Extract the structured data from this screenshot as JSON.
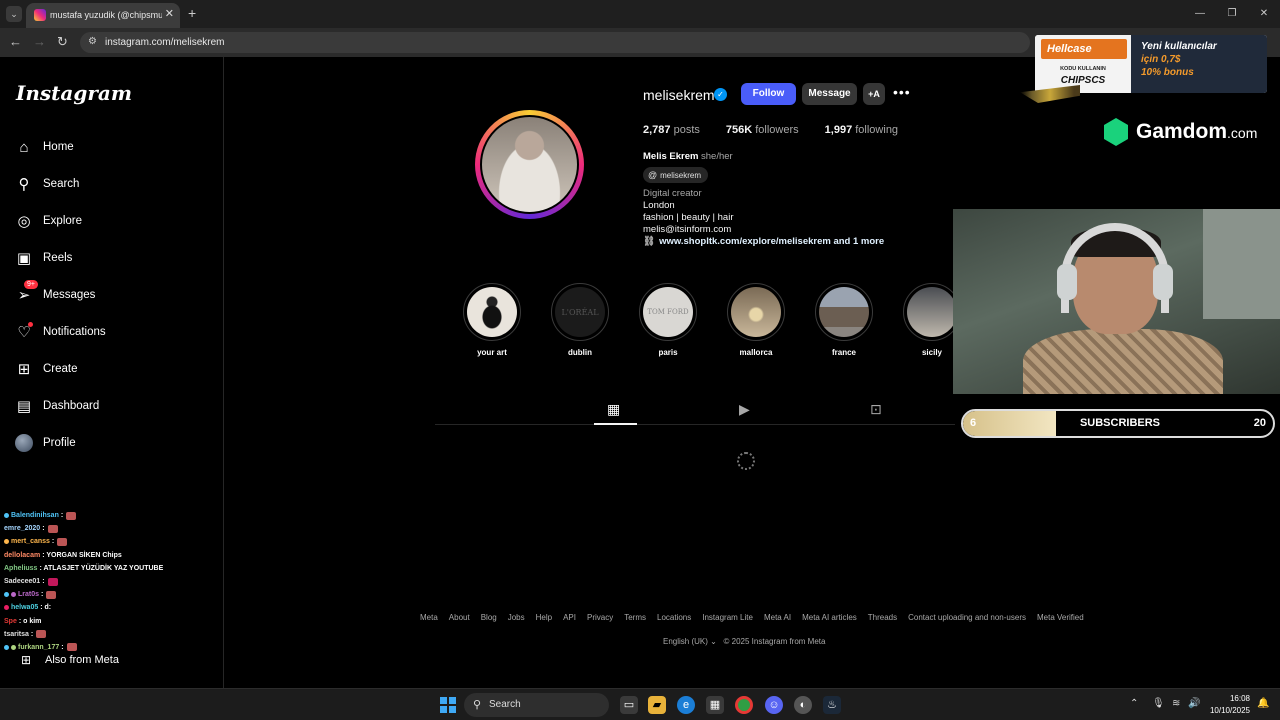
{
  "browser": {
    "tab_title": "mustafa yuzudik (@chipsmusta",
    "url": "instagram.com/melisekrem"
  },
  "sidebar": {
    "logo": "Instagram",
    "items": [
      {
        "label": "Home",
        "icon": "home-icon"
      },
      {
        "label": "Search",
        "icon": "search-icon"
      },
      {
        "label": "Explore",
        "icon": "compass-icon"
      },
      {
        "label": "Reels",
        "icon": "reels-icon"
      },
      {
        "label": "Messages",
        "icon": "messenger-icon",
        "badge": "9+"
      },
      {
        "label": "Notifications",
        "icon": "heart-icon"
      },
      {
        "label": "Create",
        "icon": "plus-square-icon"
      },
      {
        "label": "Dashboard",
        "icon": "chart-icon"
      },
      {
        "label": "Profile",
        "icon": "avatar"
      }
    ],
    "also_from_meta": "Also from Meta"
  },
  "chat": [
    {
      "user": "Balendinihsan",
      "msg": ":",
      "color": "#4fc3f7"
    },
    {
      "user": "emre_2020",
      "msg": ":",
      "color": "#a5d6ff"
    },
    {
      "user": "mert_canss",
      "msg": ":",
      "color": "#ffb74d"
    },
    {
      "user": "dellolacam",
      "msg": ": YORGAN SİKEN Chips",
      "color": "#ff8a65"
    },
    {
      "user": "Apheliuss",
      "msg": ": ATLASJET YÜZÜDİK YAZ YOUTUBE",
      "color": "#81c784"
    },
    {
      "user": "Sadecee01",
      "msg": ":",
      "color": "#e0e0e0"
    },
    {
      "user": "Lrat0s",
      "msg": ":",
      "color": "#ba68c8"
    },
    {
      "user": "helwa05",
      "msg": ": d:",
      "color": "#4dd0e1"
    },
    {
      "user": "Spe",
      "msg": ": o kim",
      "color": "#e53935"
    },
    {
      "user": "tsaritsa",
      "msg": ":",
      "color": "#e0e0e0"
    },
    {
      "user": "furkann_177",
      "msg": ":",
      "color": "#aed581"
    }
  ],
  "profile": {
    "username": "melisekrem",
    "follow": "Follow",
    "message": "Message",
    "add_user": "+A",
    "more": "•••",
    "posts": "2,787",
    "posts_label": "posts",
    "followers": "756K",
    "followers_label": "followers",
    "following": "1,997",
    "following_label": "following",
    "full_name": "Melis Ekrem",
    "pronouns": "she/her",
    "threads": "melisekrem",
    "category": "Digital creator",
    "bio": [
      "London",
      "fashion | beauty | hair",
      "melis@itsinform.com"
    ],
    "link": "www.shopltk.com/explore/melisekrem and 1 more"
  },
  "highlights": [
    {
      "label": "your art"
    },
    {
      "label": "dublin",
      "logo_text": "L'ORÉAL"
    },
    {
      "label": "paris",
      "logo_text": "TOM FORD"
    },
    {
      "label": "mallorca"
    },
    {
      "label": "france"
    },
    {
      "label": "sicily"
    }
  ],
  "footer": {
    "links": [
      "Meta",
      "About",
      "Blog",
      "Jobs",
      "Help",
      "API",
      "Privacy",
      "Terms",
      "Locations",
      "Instagram Lite",
      "Meta AI",
      "Meta AI articles",
      "Threads",
      "Contact uploading and non-users",
      "Meta Verified"
    ],
    "language": "English (UK)",
    "copyright": "© 2025 Instagram from Meta"
  },
  "ads": {
    "hellcase_brand": "Hellcase",
    "hellcase_code_label": "KODU KULLANIN",
    "hellcase_code": "CHIPSCS",
    "hellcase_line1": "Yeni kullanıcılar",
    "hellcase_line2": "için 0,7$",
    "hellcase_line3": "10% bonus",
    "gamdom": "Gamdom",
    "gamdom_tld": ".com"
  },
  "subs": {
    "current": "6",
    "label": "SUBSCRIBERS",
    "goal": "20",
    "progress": 0.3
  },
  "taskbar": {
    "search": "Search",
    "time": "16:08",
    "date": "10/10/2025"
  },
  "colors": {
    "accent": "#4a5df9",
    "verified": "#0095f6",
    "notification": "#ff3040"
  }
}
